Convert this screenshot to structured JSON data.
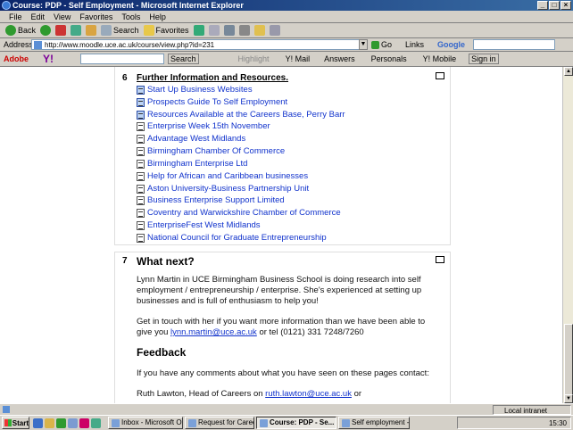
{
  "window": {
    "title": "Course: PDP - Self Employment - Microsoft Internet Explorer"
  },
  "menu": [
    "File",
    "Edit",
    "View",
    "Favorites",
    "Tools",
    "Help"
  ],
  "toolbar": {
    "back": "Back",
    "search": "Search",
    "favorites": "Favorites"
  },
  "address": {
    "label": "Address",
    "url": "http://www.moodle.uce.ac.uk/course/view.php?id=231",
    "go": "Go",
    "links": "Links",
    "google": "Google"
  },
  "yahoo_bar": {
    "adobe": "Adobe",
    "search": "Search",
    "highlight": "Highlight",
    "mail": "Y! Mail",
    "answers": "Answers",
    "personals": "Personals",
    "mobile": "Y! Mobile",
    "signin": "Sign in"
  },
  "section6": {
    "number": "6",
    "title": "Further Information and Resources.",
    "resources": [
      {
        "label": "Start Up Business Websites",
        "icon": "word-doc-icon"
      },
      {
        "label": "Prospects Guide To Self Employment",
        "icon": "word-doc-icon"
      },
      {
        "label": "Resources Available at the Careers Base, Perry Barr",
        "icon": "word-doc-icon"
      },
      {
        "label": "Enterprise Week 15th November",
        "icon": "doc-icon"
      },
      {
        "label": "Advantage West Midlands",
        "icon": "doc-icon"
      },
      {
        "label": "Birmingham Chamber Of Commerce",
        "icon": "doc-icon"
      },
      {
        "label": "Birmingham Enterprise Ltd",
        "icon": "doc-icon"
      },
      {
        "label": "Help for African and Caribbean businesses",
        "icon": "doc-icon"
      },
      {
        "label": "Aston University-Business Partnership Unit",
        "icon": "doc-icon"
      },
      {
        "label": "Business Enterprise Support Limited",
        "icon": "doc-icon"
      },
      {
        "label": "Coventry and Warwickshire Chamber of Commerce",
        "icon": "doc-icon"
      },
      {
        "label": "EnterpriseFest West Midlands",
        "icon": "doc-icon"
      },
      {
        "label": "National Council for Graduate Entrepreneurship",
        "icon": "doc-icon"
      }
    ]
  },
  "section7": {
    "number": "7",
    "heading": "What next?",
    "para1": "Lynn Martin in UCE Birmingham Business School is doing research into self employment / entrepreneurship / enterprise. She's experienced at setting up businesses and is full of enthusiasm to help you!",
    "para2_a": "Get in touch with her if you want more information than we have been able to give you",
    "email1": "lynn.martin@uce.ac.uk",
    "para2_b": "or tel (0121) 331 7248/7260",
    "feedback_heading": "Feedback",
    "para3": "If you have any comments about what you have seen on these pages contact:",
    "para4_a": "Ruth Lawton, Head of Careers on",
    "email2": "ruth.lawton@uce.ac.uk",
    "para4_b": "or"
  },
  "status": {
    "zone": "Local intranet"
  },
  "taskbar": {
    "start": "Start",
    "tasks": [
      "Inbox - Microsoft Outl...",
      "Request for Careers ...",
      "Course: PDP - Se...",
      "Self employment - sup..."
    ],
    "clock": "15:30"
  }
}
